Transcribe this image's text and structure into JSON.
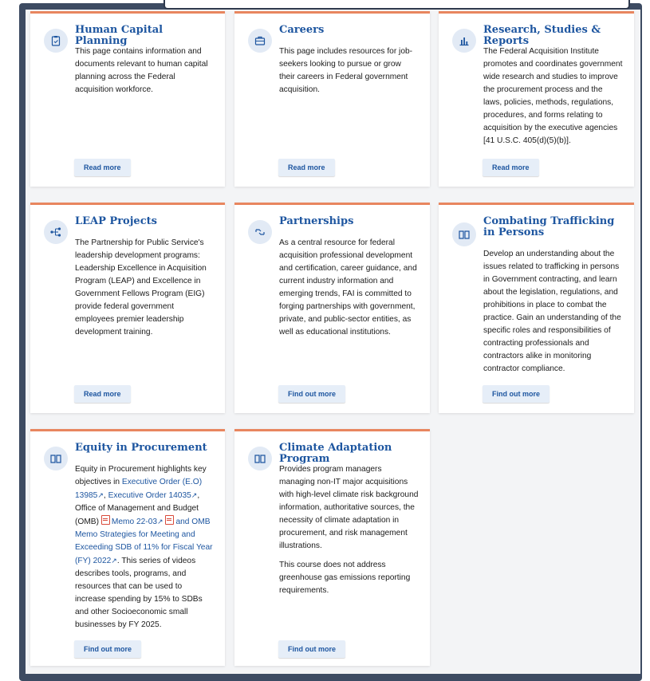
{
  "cards": [
    {
      "title": "Human Capital Planning",
      "icon": "clipboard-icon",
      "body": "This page contains information and documents relevant to human capital planning across the Federal acquisition workforce.",
      "button": "Read more"
    },
    {
      "title": "Careers",
      "icon": "briefcase-icon",
      "body": "This page includes resources for job-seekers looking to pursue or grow their careers in Federal government acquisition.",
      "button": "Read more"
    },
    {
      "title": "Research, Studies & Reports",
      "icon": "bar-chart-icon",
      "body": "The Federal Acquisition Institute promotes and coordinates government wide research and studies to improve the procurement process and the laws, policies, methods, regulations, procedures, and forms relating to acquisition by the executive agencies [41 U.S.C. 405(d)(5)(b)].",
      "button": "Read more"
    },
    {
      "title": "LEAP Projects",
      "icon": "flow-icon",
      "body": "The Partnership for Public Service's leadership development programs: Leadership Excellence in Acquisition Program (LEAP) and Excellence in Government Fellows Program (EIG) provide federal government employees premier leadership development training.",
      "button": "Read more"
    },
    {
      "title": "Partnerships",
      "icon": "handshake-icon",
      "body": "As a central resource for federal acquisition professional development and certification, career guidance, and current industry information and emerging trends, FAI is committed to forging partnerships with government, private, and public-sector entities, as well as educational institutions.",
      "button": "Find out more"
    },
    {
      "title": "Combating Trafficking in Persons",
      "icon": "book-icon",
      "body": "Develop an understanding about the issues related to trafficking in persons in Government contracting, and learn about the legislation, regulations, and prohibitions in place to combat the practice. Gain an understanding of the specific roles and responsibilities of contracting professionals and contractors alike in monitoring contractor compliance.",
      "button": "Find out more"
    },
    {
      "title": "Equity in Procurement",
      "icon": "book-icon",
      "body_intro": "Equity in Procurement highlights key objectives in",
      "link_eo_13985": "Executive Order (E.O) 13985",
      "sep1": ",",
      "link_eo_14035": "Executive Order 14035",
      "body_omb": ", Office of Management and Budget (OMB)",
      "link_memo": "Memo 22-03",
      "link_and": "and",
      "link_strategies": "OMB Memo Strategies for Meeting and Exceeding SDB of 11% for Fiscal Year (FY) 2022",
      "body_tail": ". This series of videos describes tools, programs, and resources that can be used to increase spending by 15% to SDBs and other Socioeconomic small businesses by FY 2025.",
      "button": "Find out more"
    },
    {
      "title": "Climate Adaptation Program",
      "icon": "book-icon",
      "body": "Provides program managers managing non-IT major acquisitions with high-level climate risk background information, authoritative sources, the necessity of climate adaptation in procurement, and risk management illustrations.",
      "body2": "This course does not address greenhouse gas emissions reporting requirements.",
      "button": "Find out more"
    }
  ],
  "colors": {
    "accent": "#e8865f",
    "link": "#1e56a0",
    "frame": "#3d4b62"
  }
}
